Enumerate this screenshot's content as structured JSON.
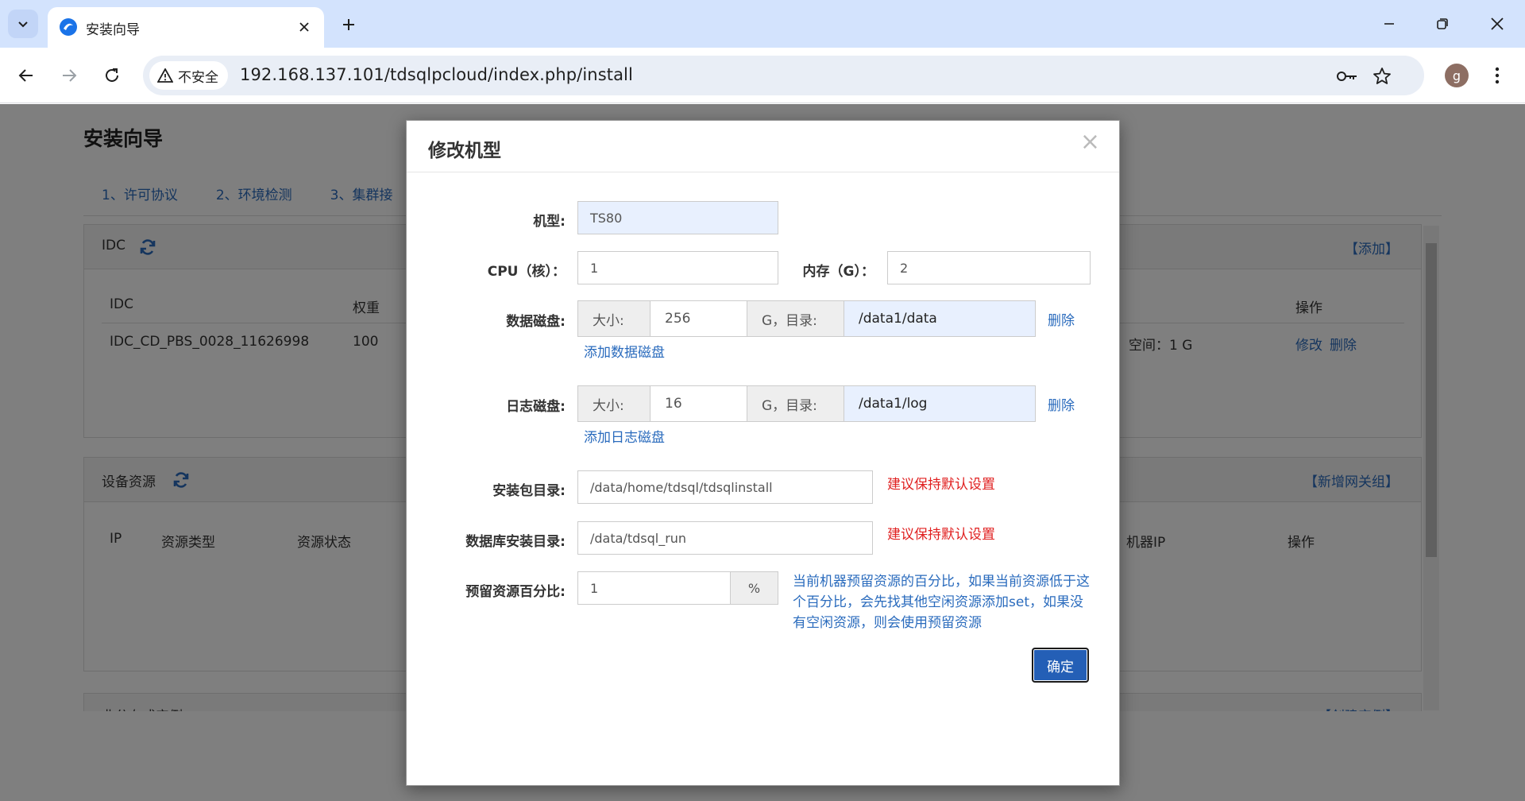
{
  "browser": {
    "tab_title": "安装向导",
    "security_label": "不安全",
    "url": "192.168.137.101/tdsqlpcloud/index.php/install",
    "avatar_letter": "g"
  },
  "page": {
    "title": "安装向导",
    "steps": [
      "1、许可协议",
      "2、环境检测",
      "3、集群接"
    ],
    "idc_panel": {
      "title": "IDC",
      "action": "【添加】",
      "headers": {
        "idc": "IDC",
        "weight": "权重",
        "op": "操作"
      },
      "row": {
        "idc": "IDC_CD_PBS_0028_11626998",
        "weight": "100",
        "space": "空间：1 G",
        "edit": "修改",
        "delete": "删除"
      }
    },
    "device_panel": {
      "title": "设备资源",
      "action": "【新增网关组】",
      "headers": {
        "ip": "IP",
        "type": "资源类型",
        "status": "资源状态",
        "machine_ip": "机器IP",
        "op": "操作"
      }
    },
    "instance_panel": {
      "title": "非分布式实例",
      "action": "【创建实例】"
    }
  },
  "modal": {
    "title": "修改机型",
    "close": "×",
    "model_label": "机型:",
    "model_value": "TS80",
    "cpu_label": "CPU（核）：",
    "cpu_value": "1",
    "mem_label": "内存（G）：",
    "mem_value": "2",
    "data_disk_label": "数据磁盘:",
    "log_disk_label": "日志磁盘:",
    "size_label": "大小:",
    "dir_label": "G，目录:",
    "data_size": "256",
    "data_dir": "/data1/data",
    "log_size": "16",
    "log_dir": "/data1/log",
    "delete_label": "删除",
    "add_data_disk": "添加数据磁盘",
    "add_log_disk": "添加日志磁盘",
    "pkg_dir_label": "安装包目录:",
    "pkg_dir_value": "/data/home/tdsql/tdsqlinstall",
    "db_dir_label": "数据库安装目录:",
    "db_dir_value": "/data/tdsql_run",
    "warn_text": "建议保持默认设置",
    "reserve_label": "预留资源百分比:",
    "reserve_value": "1",
    "percent": "%",
    "reserve_hint": "当前机器预留资源的百分比，如果当前资源低于这个百分比，会先找其他空闲资源添加set，如果没有空闲资源，则会使用预留资源",
    "ok_button": "确定"
  }
}
